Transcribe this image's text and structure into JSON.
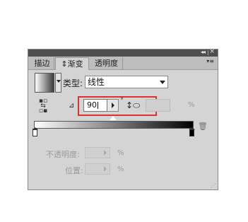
{
  "titlebar": {
    "collapse_glyph": "◂◂",
    "close_glyph": "×"
  },
  "tabs": [
    {
      "label": "描边"
    },
    {
      "label": "⇕渐变"
    },
    {
      "label": "透明度"
    }
  ],
  "panel_menu_glyph": "▾≡",
  "gradient": {
    "type_label": "类型:",
    "type_value": "线性",
    "angle_value": "90",
    "angle_unit": "°",
    "aspect_unit": "%",
    "stops": [
      {
        "color": "#ffffff",
        "location": 0
      },
      {
        "color": "#000000",
        "location": 100
      }
    ]
  },
  "opacity": {
    "label": "不透明度:",
    "unit": "%"
  },
  "position": {
    "label": "位置:",
    "unit": "%"
  },
  "icons": {
    "reverse": "reverse-gradient-icon",
    "angle": "angle-icon",
    "aspect": "aspect-ratio-icon",
    "trash": "trash-icon"
  },
  "colors": {
    "highlight_box": "#e03030",
    "panel_bg": "#d4d4d4"
  }
}
